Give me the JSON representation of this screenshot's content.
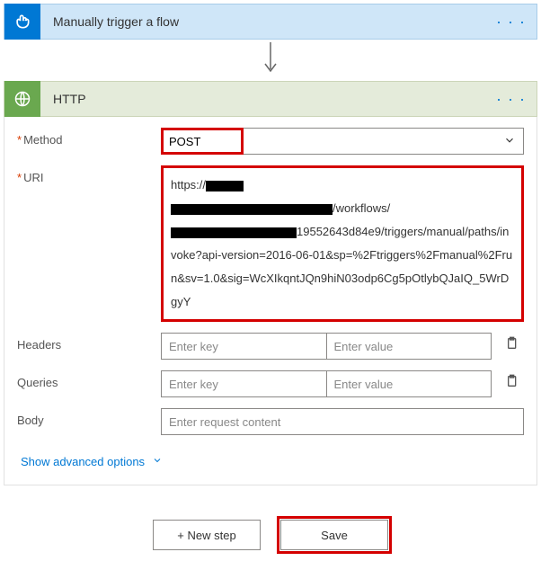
{
  "trigger": {
    "title": "Manually trigger a flow"
  },
  "http": {
    "title": "HTTP",
    "method_label": "Method",
    "method_value": "POST",
    "uri_label": "URI",
    "uri_prefix": "https://",
    "uri_mid1": "/workflows/",
    "uri_tail": "19552643d84e9/triggers/manual/paths/invoke?api-version=2016-06-01&sp=%2Ftriggers%2Fmanual%2Frun&sv=1.0&sig=WcXIkqntJQn9hiN03odp6Cg5pOtlybQJaIQ_5WrDgyY",
    "headers_label": "Headers",
    "queries_label": "Queries",
    "body_label": "Body",
    "key_placeholder": "Enter key",
    "value_placeholder": "Enter value",
    "body_placeholder": "Enter request content",
    "advanced": "Show advanced options"
  },
  "buttons": {
    "new_step": "+ New step",
    "save": "Save"
  }
}
